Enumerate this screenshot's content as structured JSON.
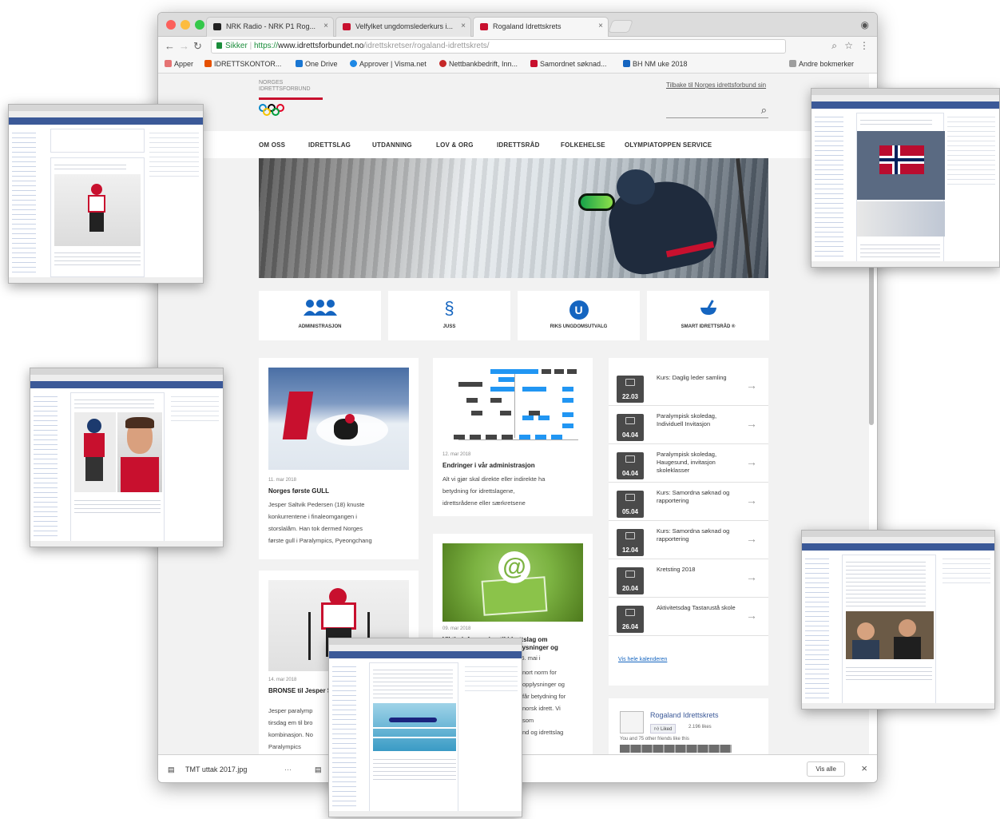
{
  "browser": {
    "tabs": [
      {
        "label": "NRK Radio - NRK P1 Rog..."
      },
      {
        "label": "Velfylket ungdomslederkurs i..."
      },
      {
        "label": "Rogaland Idrettskrets"
      }
    ],
    "address": {
      "secure_label": "Sikker",
      "protocol": "https://",
      "host": "www.idrettsforbundet.no",
      "path": "/idrettskretser/rogaland-idrettskrets/"
    },
    "bookmarks": [
      {
        "label": "Apper"
      },
      {
        "label": "IDRETTSKONTOR..."
      },
      {
        "label": "One Drive"
      },
      {
        "label": "Approver | Visma.net"
      },
      {
        "label": "Nettbankbedrift, Inn..."
      },
      {
        "label": "Samordnet søknad..."
      },
      {
        "label": "BH NM uke 2018"
      }
    ],
    "other_bookmarks": "Andre bokmerker"
  },
  "site": {
    "logo_text": "NORGES IDRETTSFORBUND",
    "top_link": "Tilbake til Norges idrettsforbund sin",
    "nav": [
      "OM OSS",
      "IDRETTSLAG",
      "UTDANNING",
      "LOV & ORG",
      "IDRETTSRÅD",
      "FOLKEHELSE",
      "OLYMPIATOPPEN SERVICE"
    ],
    "quick_links": [
      {
        "label": "ADMINISTRASJON",
        "icon": "people-icon"
      },
      {
        "label": "JUSS",
        "icon": "paragraph-icon"
      },
      {
        "label": "RIKS UNGDOMSUTVALG",
        "icon": "u-circle-icon"
      },
      {
        "label": "SMART IDRETTSRÅD ®",
        "icon": "bowl-icon"
      }
    ],
    "news": [
      {
        "date": "11. mar 2018",
        "title": "Norges første GULL",
        "text": [
          "Jesper Saltvik Pedersen (18) knuste",
          "konkurrentene i finaleomgangen i",
          "storslalåm. Han tok dermed Norges",
          "første gull i Paralympics, Pyeongchang"
        ]
      },
      {
        "date": "12. mar 2018",
        "title": "Endringer i vår administrasjon",
        "text": [
          "Alt vi gjør skal direkte eller indirekte ha",
          "betydning for idrettslagene,",
          "idrettsrådene eller særkretsene"
        ]
      },
      {
        "date": "09. mar 2018",
        "title": "Viktig informasjon til idrettslag om behandling av personopplysninger og",
        "text": [
          "ny personvernforordning fra 25. mai i",
          "nort norm for",
          "opplysninger og",
          "får betydning for",
          "norsk idrett. Vi",
          "som",
          "nd og idrettslag"
        ]
      },
      {
        "date": "14. mar 2018",
        "title": "BRONSE til Jesper Saltvik og Akerhamn, Kari",
        "text": [
          "Jesper paralymp",
          "tirsdag em til bro",
          "kombinasjon. No",
          "Paralympics"
        ]
      }
    ],
    "calendar": [
      {
        "date": "22.03",
        "title": "Kurs: Daglig leder samling"
      },
      {
        "date": "04.04",
        "title": "Paralympisk skoledag, Individuell Invitasjon"
      },
      {
        "date": "04.04",
        "title": "Paralympisk skoledag, Haugesund, invitasjon skoleklasser"
      },
      {
        "date": "05.04",
        "title": "Kurs: Samordna søknad og rapportering"
      },
      {
        "date": "12.04",
        "title": "Kurs: Samordna søknad og rapportering"
      },
      {
        "date": "20.04",
        "title": "Kretsting 2018"
      },
      {
        "date": "26.04",
        "title": "Aktivitetsdag Tastarustå skole"
      }
    ],
    "calendar_link": "Vis hele kalenderen",
    "facebook": {
      "page_name": "Rogaland Idrettskrets",
      "like": "Liked",
      "likes_count": "2.196 likes",
      "friends_text": "You and 75 other friends like this"
    }
  },
  "downloads": {
    "file": "TMT uttak 2017.jpg",
    "show_all": "Vis alle"
  },
  "colors": {
    "accent": "#1565c0",
    "nif_red": "#c8102e",
    "facebook_blue": "#3b5998",
    "org_blue": "#2196f3"
  }
}
